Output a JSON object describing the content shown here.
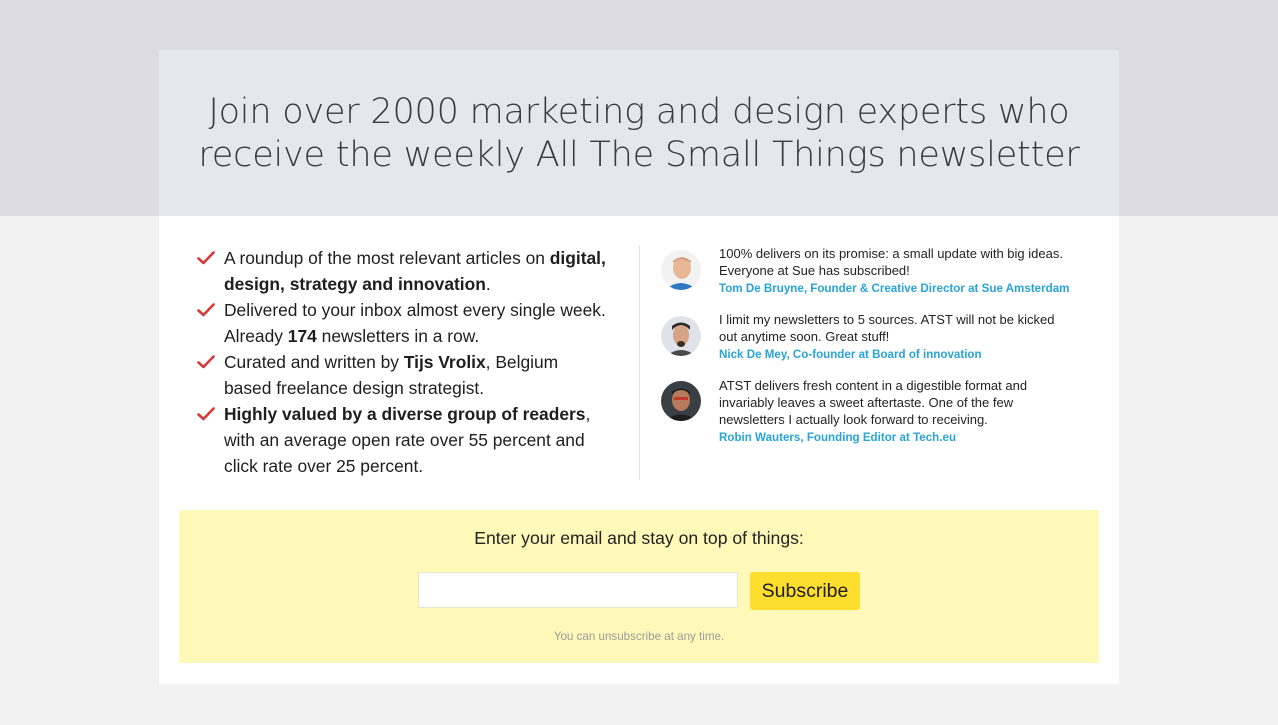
{
  "headline": {
    "line1": "Join over 2000 marketing and design experts who",
    "line2": "receive the weekly All The Small Things newsletter"
  },
  "benefits": [
    {
      "parts": [
        "A roundup of the most relevant articles on ",
        "digital, design, strategy and innovation",
        "."
      ]
    },
    {
      "parts": [
        "Delivered to your inbox almost every single week. Already ",
        "174",
        " newsletters in a row."
      ]
    },
    {
      "parts": [
        "Curated and written by ",
        "Tijs Vrolix",
        ", Belgium based freelance design strategist."
      ]
    },
    {
      "parts": [
        "",
        "Highly valued by a diverse group of readers",
        ", with an average open rate over 55 percent and click rate over 25 percent."
      ]
    }
  ],
  "testimonials": [
    {
      "quote": "100% delivers on its promise: a small update with big ideas. Everyone at Sue has subscribed!",
      "author": "Tom De Bruyne, Founder & Creative Director at Sue Amsterdam"
    },
    {
      "quote": "I limit my newsletters to 5 sources. ATST will not be kicked out anytime soon. Great stuff!",
      "author": "Nick De Mey, Co-founder at Board of innovation"
    },
    {
      "quote": "ATST delivers fresh content in a digestible format and invariably leaves a sweet aftertaste. One of the few newsletters I actually look forward to receiving.",
      "author": "Robin Wauters, Founding Editor at Tech.eu"
    }
  ],
  "signup": {
    "prompt": "Enter your email and stay on top of things:",
    "email_value": "",
    "email_placeholder": "",
    "button_label": "Subscribe",
    "note": "You can unsubscribe at any time."
  },
  "icons": {
    "check": "check-icon",
    "avatar": "avatar-photo"
  },
  "colors": {
    "accent_check": "#d63a3a",
    "author_link": "#28a4d9",
    "signup_bg": "#fff9b9",
    "button_bg": "#fddd2e",
    "hero_bg": "#e6e7e8"
  }
}
